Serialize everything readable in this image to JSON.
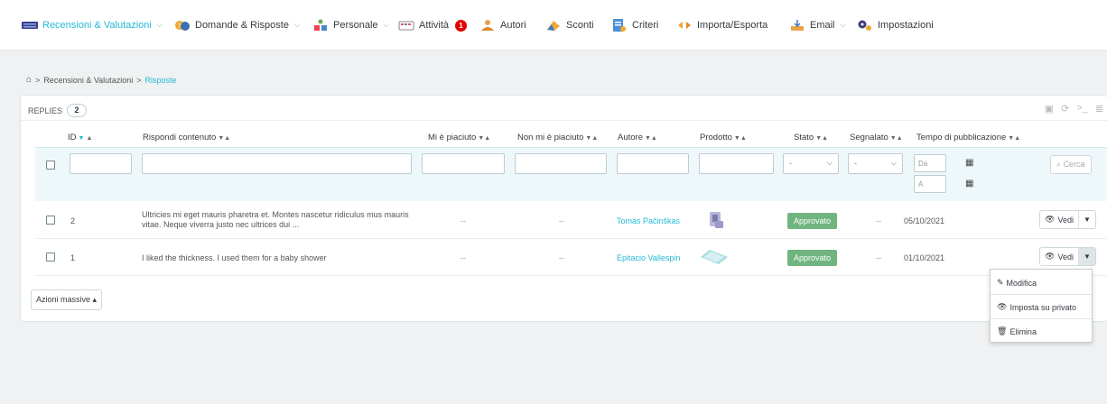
{
  "nav": {
    "items": [
      {
        "label": "Recensioni & Valutazioni",
        "icon": "reviews-icon",
        "chevron": true,
        "active": true
      },
      {
        "label": "Domande & Risposte",
        "icon": "questions-icon",
        "chevron": true
      },
      {
        "label": "Personale",
        "icon": "staff-icon",
        "chevron": true
      },
      {
        "label": "Attività",
        "icon": "activity-icon",
        "badge": "1"
      },
      {
        "label": "Autori",
        "icon": "authors-icon"
      },
      {
        "label": "Sconti",
        "icon": "discount-icon"
      },
      {
        "label": "Criteri",
        "icon": "criteria-icon"
      },
      {
        "label": "Importa/Esporta",
        "icon": "import-export-icon"
      },
      {
        "label": "Email",
        "icon": "email-icon",
        "chevron": true
      },
      {
        "label": "Impostazioni",
        "icon": "settings-icon"
      }
    ]
  },
  "breadcrumb": {
    "parent": "Recensioni & Valutazioni",
    "separator": ">",
    "current": "Risposte"
  },
  "panel": {
    "title": "REPLIES",
    "count": "2"
  },
  "columns": {
    "id": "ID",
    "content": "Rispondi contenuto",
    "liked": "Mi è piaciuto",
    "disliked": "Non mi è piaciuto",
    "author": "Autore",
    "product": "Prodotto",
    "status": "Stato",
    "reported": "Segnalato",
    "published": "Tempo di pubblicazione"
  },
  "filters": {
    "status_select": "-",
    "reported_select": "-",
    "date_from_placeholder": "Da",
    "date_to_placeholder": "A",
    "search_button": "Cerca"
  },
  "rows": [
    {
      "id": "2",
      "content": "Ultricies mi eget mauris pharetra et. Montes nascetur ridiculus mus mauris vitae. Neque viverra justo nec ultrices dui ...",
      "liked": "--",
      "disliked": "--",
      "author": "Tomas Pačinškas",
      "status": "Approvato",
      "reported": "--",
      "date": "05/10/2021",
      "view": "Vedi"
    },
    {
      "id": "1",
      "content": "I liked the thickness. I used them for a baby shower",
      "liked": "--",
      "disliked": "--",
      "author": "Epitacio Vallespin",
      "status": "Approvato",
      "reported": "--",
      "date": "01/10/2021",
      "view": "Vedi"
    }
  ],
  "bulk_actions": "Azioni massive",
  "row_menu": {
    "edit": "Modifica",
    "set_private": "Imposta su privato",
    "delete": "Elimina"
  },
  "colors": {
    "accent": "#25b9d7",
    "approved": "#70b580",
    "badge": "#e30000"
  }
}
